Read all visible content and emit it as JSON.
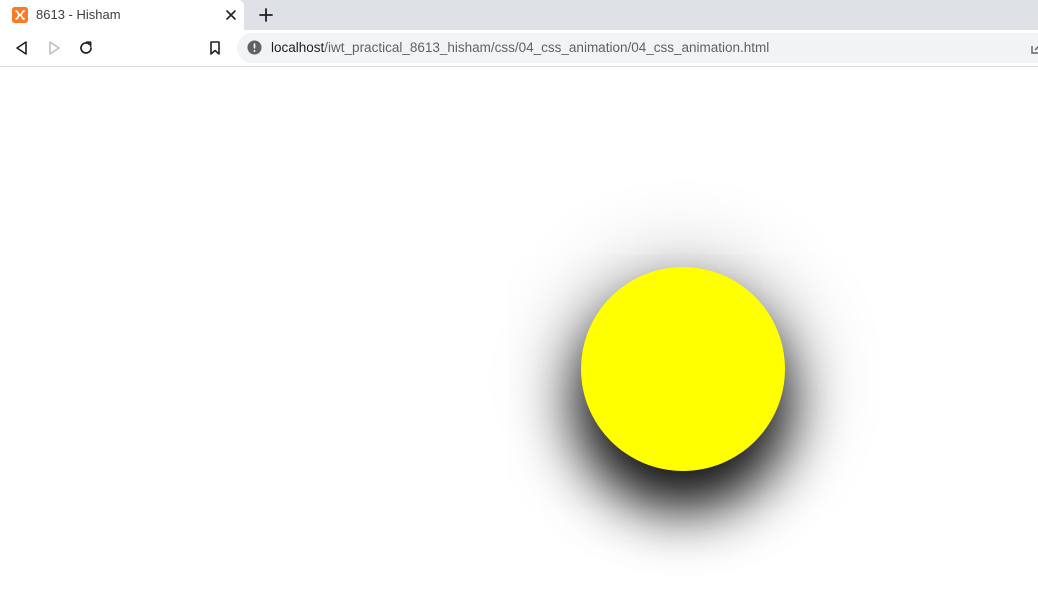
{
  "tab": {
    "title": "8613 - Hisham",
    "favicon": "xampp-icon",
    "favicon_color": "#fb7a24"
  },
  "toolbar": {
    "back_icon": "back-arrow-icon",
    "forward_icon": "forward-arrow-icon",
    "reload_icon": "reload-icon",
    "bookmark_icon": "bookmark-icon"
  },
  "address_bar": {
    "host": "localhost",
    "path": "/iwt_practical_8613_hisham/css/04_css_animation/04_css_animation.html",
    "info_icon": "info-icon"
  },
  "page": {
    "ball_color": "#ffff00",
    "shadow_color": "#000000"
  }
}
